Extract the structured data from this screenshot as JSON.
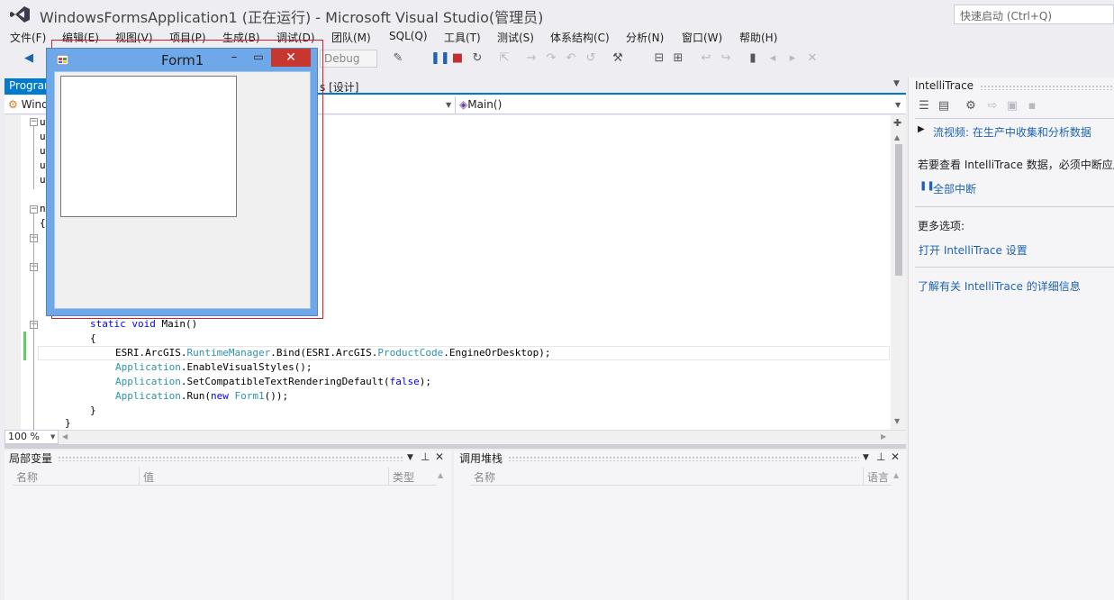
{
  "window": {
    "title": "WindowsFormsApplication1 (正在运行) - Microsoft Visual Studio(管理员)",
    "quick_launch_placeholder": "快速启动 (Ctrl+Q)"
  },
  "menu": [
    "文件(F)",
    "编辑(E)",
    "视图(V)",
    "项目(P)",
    "生成(B)",
    "调试(D)",
    "团队(M)",
    "SQL(Q)",
    "工具(T)",
    "测试(S)",
    "体系结构(C)",
    "分析(N)",
    "窗口(W)",
    "帮助(H)"
  ],
  "toolbar": {
    "configuration": "Debug"
  },
  "editor": {
    "tab_program": "Program.cs",
    "tab_design": "s [设计]",
    "nav_left": "Wind",
    "nav_right": "Main()",
    "zoom": "100 %",
    "gutter_fragments": [
      "u",
      "u",
      "u",
      "u",
      "u",
      "n",
      "{"
    ],
    "code": {
      "main_decl_kw1": "static",
      "main_decl_kw2": "void",
      "main_decl_rest": " Main()",
      "brace_open": "{",
      "l1_a": "ESRI.ArcGIS.",
      "l1_b": "RuntimeManager",
      "l1_c": ".Bind(ESRI.ArcGIS.",
      "l1_d": "ProductCode",
      "l1_e": ".EngineOrDesktop);",
      "l2_a": "Application",
      "l2_b": ".EnableVisualStyles();",
      "l3_a": "Application",
      "l3_b": ".SetCompatibleTextRenderingDefault(",
      "l3_c": "false",
      "l3_d": ");",
      "l4_a": "Application",
      "l4_b": ".Run(",
      "l4_c": "new",
      "l4_d": " ",
      "l4_e": "Form1",
      "l4_f": "());",
      "brace_close": "}",
      "brace_close2": "}"
    }
  },
  "locals_panel": {
    "title": "局部变量",
    "columns": [
      "名称",
      "值",
      "类型"
    ]
  },
  "callstack_panel": {
    "title": "调用堆栈",
    "columns": [
      "名称",
      "语言"
    ]
  },
  "intellitrace": {
    "title": "IntelliTrace",
    "video_link": "流视频: 在生产中收集和分析数据",
    "notice": "若要查看 IntelliTrace 数据，必须中断应用程序",
    "break_all": "全部中断",
    "more_options": "更多选项:",
    "open_settings": "打开 IntelliTrace 设置",
    "learn_more": "了解有关 IntelliTrace 的详细信息"
  },
  "form": {
    "title": "Form1"
  },
  "icons": {
    "back": "back-arrow-icon",
    "pause": "pause-icon",
    "stop": "stop-icon",
    "restart": "restart-icon"
  }
}
